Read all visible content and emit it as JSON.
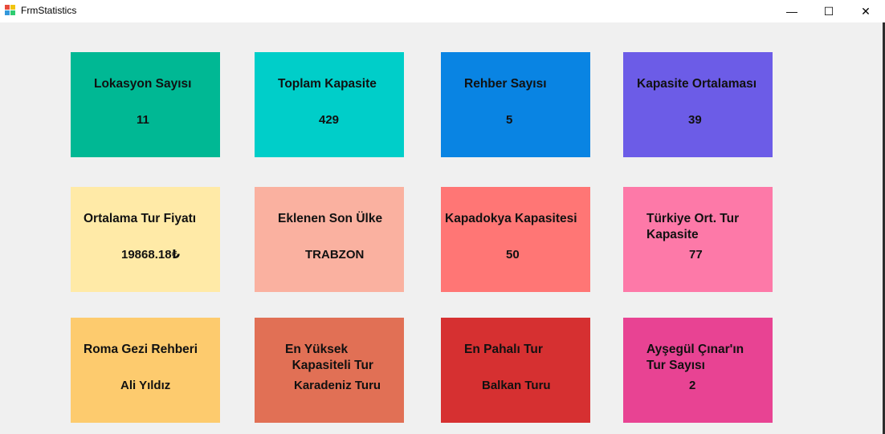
{
  "window": {
    "title": "FrmStatistics",
    "minimize_glyph": "—",
    "maximize_glyph": "☐",
    "close_glyph": "✕"
  },
  "colors": {
    "background": "#f0f0f0",
    "titlebar": "#ffffff"
  },
  "cards": [
    {
      "label": "Lokasyon Sayısı",
      "value": "11",
      "color": "#00b894"
    },
    {
      "label": "Toplam Kapasite",
      "value": "429",
      "color": "#00cec9"
    },
    {
      "label": "Rehber Sayısı",
      "value": "5",
      "color": "#0984e3"
    },
    {
      "label": "Kapasite Ortalaması",
      "value": "39",
      "color": "#6c5ce7"
    },
    {
      "label": "Ortalama Tur Fiyatı",
      "value": "19868.18₺",
      "color": "#ffeaa7"
    },
    {
      "label": "Eklenen Son Ülke",
      "value": "TRABZON",
      "color": "#fab1a0"
    },
    {
      "label": "Kapadokya Kapasitesi",
      "value": "50",
      "color": "#ff7675"
    },
    {
      "label": "Türkiye Ort. Tur\nKapasite",
      "value": "77",
      "color": "#fd79a8"
    },
    {
      "label": "Roma Gezi Rehberi",
      "value": "Ali Yıldız",
      "color": "#fdcb6e"
    },
    {
      "label": "En Yüksek\n  Kapasiteli Tur",
      "value": "Karadeniz Turu",
      "color": "#e17055"
    },
    {
      "label": "En Pahalı Tur",
      "value": "Balkan Turu",
      "color": "#d63031"
    },
    {
      "label": "Ayşegül Çınar'ın\nTur Sayısı",
      "value": "2",
      "color": "#e84393"
    }
  ]
}
